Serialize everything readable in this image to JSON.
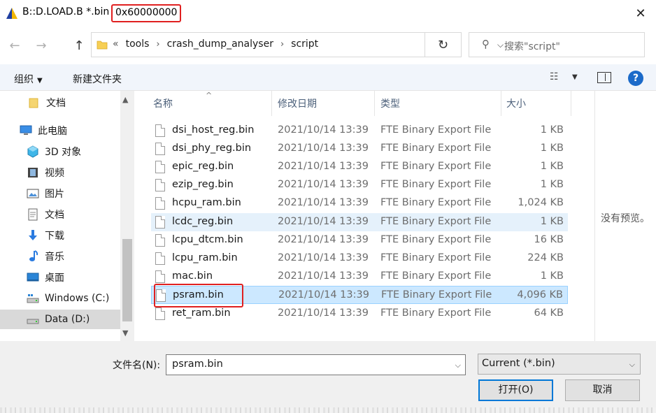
{
  "window": {
    "title": "B::D.LOAD.B *.bin",
    "title_highlight": "0x60000000",
    "close_glyph": "✕"
  },
  "nav": {
    "back_glyph": "←",
    "forward_glyph": "→",
    "up_glyph": "↑",
    "refresh_glyph": "↻"
  },
  "address": {
    "prefix": "«",
    "crumbs": [
      "tools",
      "crash_dump_analyser",
      "script"
    ],
    "separator": "›"
  },
  "search": {
    "placeholder": "搜索\"script\"",
    "icon": "search-icon"
  },
  "toolbar": {
    "organize": "组织",
    "new_folder": "新建文件夹",
    "help": "?"
  },
  "sidebar": {
    "items": [
      {
        "label": "文档",
        "icon": "folder-icon"
      },
      {
        "label": "此电脑",
        "icon": "computer-icon"
      },
      {
        "label": "3D 对象",
        "icon": "3d-objects-icon"
      },
      {
        "label": "视频",
        "icon": "video-icon"
      },
      {
        "label": "图片",
        "icon": "pictures-icon"
      },
      {
        "label": "文档",
        "icon": "documents-icon"
      },
      {
        "label": "下载",
        "icon": "download-icon"
      },
      {
        "label": "音乐",
        "icon": "music-icon"
      },
      {
        "label": "桌面",
        "icon": "desktop-icon"
      },
      {
        "label": "Windows (C:)",
        "icon": "drive-icon"
      },
      {
        "label": "Data (D:)",
        "icon": "drive-icon",
        "selected": true
      }
    ]
  },
  "columns": {
    "name": "名称",
    "date": "修改日期",
    "type": "类型",
    "size": "大小"
  },
  "files": [
    {
      "name": "dsi_host_reg.bin",
      "date": "2021/10/14 13:39",
      "type": "FTE Binary Export File",
      "size": "1 KB"
    },
    {
      "name": "dsi_phy_reg.bin",
      "date": "2021/10/14 13:39",
      "type": "FTE Binary Export File",
      "size": "1 KB"
    },
    {
      "name": "epic_reg.bin",
      "date": "2021/10/14 13:39",
      "type": "FTE Binary Export File",
      "size": "1 KB"
    },
    {
      "name": "ezip_reg.bin",
      "date": "2021/10/14 13:39",
      "type": "FTE Binary Export File",
      "size": "1 KB"
    },
    {
      "name": "hcpu_ram.bin",
      "date": "2021/10/14 13:39",
      "type": "FTE Binary Export File",
      "size": "1,024 KB"
    },
    {
      "name": "lcdc_reg.bin",
      "date": "2021/10/14 13:39",
      "type": "FTE Binary Export File",
      "size": "1 KB",
      "state": "hover"
    },
    {
      "name": "lcpu_dtcm.bin",
      "date": "2021/10/14 13:39",
      "type": "FTE Binary Export File",
      "size": "16 KB"
    },
    {
      "name": "lcpu_ram.bin",
      "date": "2021/10/14 13:39",
      "type": "FTE Binary Export File",
      "size": "224 KB"
    },
    {
      "name": "mac.bin",
      "date": "2021/10/14 13:39",
      "type": "FTE Binary Export File",
      "size": "1 KB"
    },
    {
      "name": "psram.bin",
      "date": "2021/10/14 13:39",
      "type": "FTE Binary Export File",
      "size": "4,096 KB",
      "state": "selected"
    },
    {
      "name": "ret_ram.bin",
      "date": "2021/10/14 13:39",
      "type": "FTE Binary Export File",
      "size": "64 KB"
    }
  ],
  "preview": {
    "text": "没有预览。"
  },
  "footer": {
    "filename_label": "文件名(N):",
    "filename_value": "psram.bin",
    "filetype_value": "Current (*.bin)",
    "open_label": "打开(O)",
    "cancel_label": "取消"
  },
  "colors": {
    "accent": "#0078d7",
    "highlight_box": "#e02020",
    "selected_row": "#cce8ff",
    "hover_row": "#e5f1fb"
  }
}
